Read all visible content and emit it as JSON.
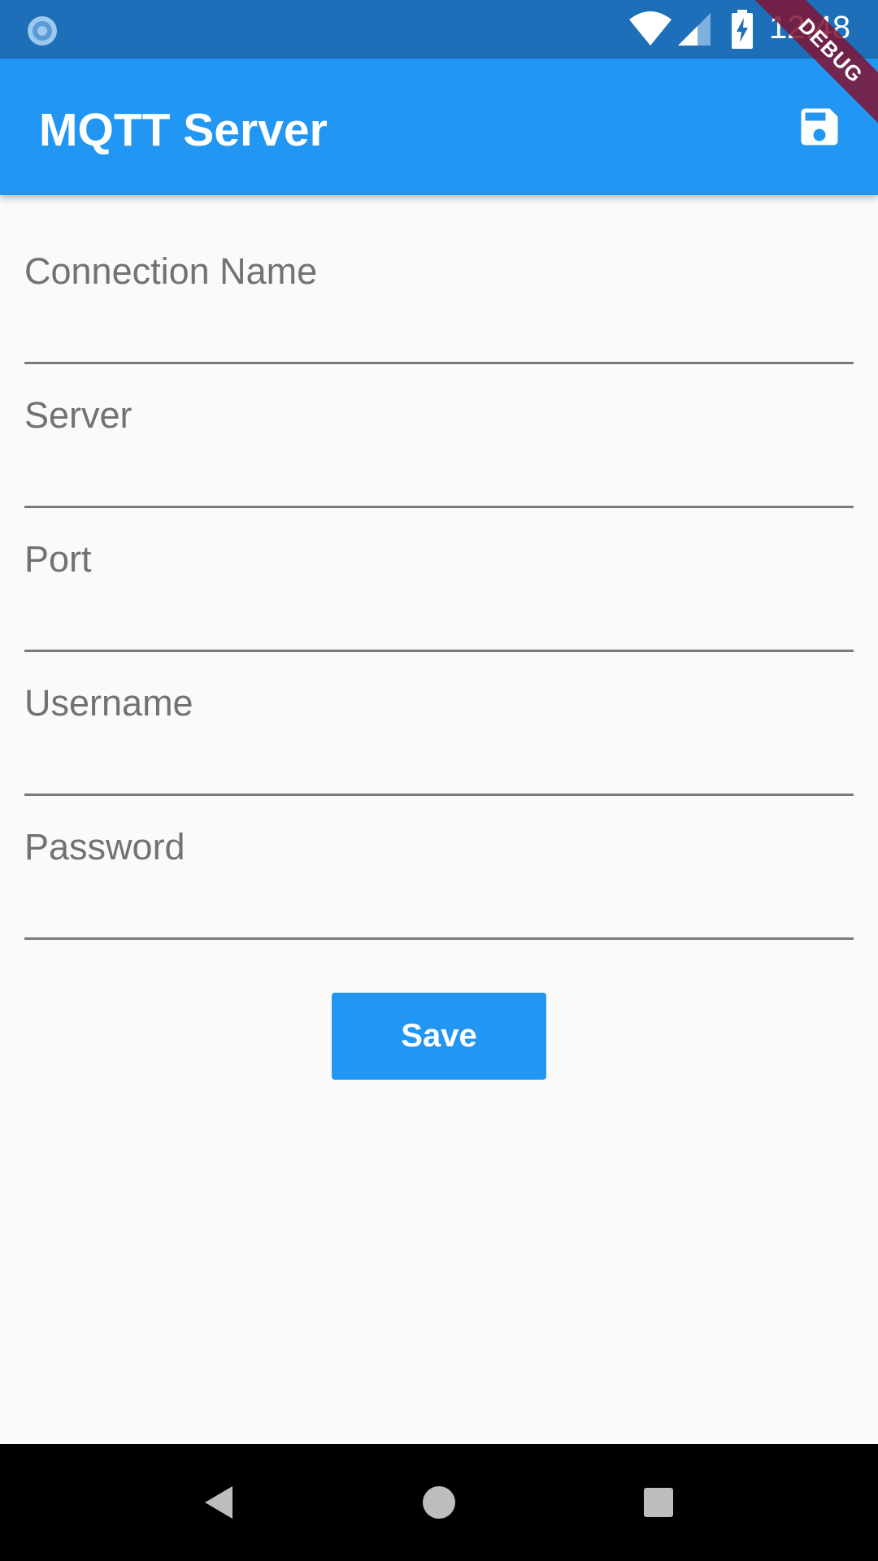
{
  "status_bar": {
    "time": "12:48",
    "icons": [
      "loading-icon",
      "wifi-icon",
      "signal-icon",
      "battery-charging-icon"
    ]
  },
  "app_bar": {
    "title": "MQTT Server",
    "action_icon": "save-icon",
    "background_color": "#2196F3"
  },
  "debug_banner": {
    "label": "DEBUG"
  },
  "form": {
    "fields": [
      {
        "label": "Connection Name",
        "value": ""
      },
      {
        "label": "Server",
        "value": ""
      },
      {
        "label": "Port",
        "value": ""
      },
      {
        "label": "Username",
        "value": ""
      },
      {
        "label": "Password",
        "value": ""
      }
    ],
    "save_label": "Save"
  },
  "nav_bar": {
    "icons": [
      "back-icon",
      "home-icon",
      "recents-icon"
    ]
  },
  "colors": {
    "status_bar": "#1C6FB8",
    "accent": "#2196F3",
    "background": "#FAFAFA",
    "debug_banner": "#801333"
  }
}
